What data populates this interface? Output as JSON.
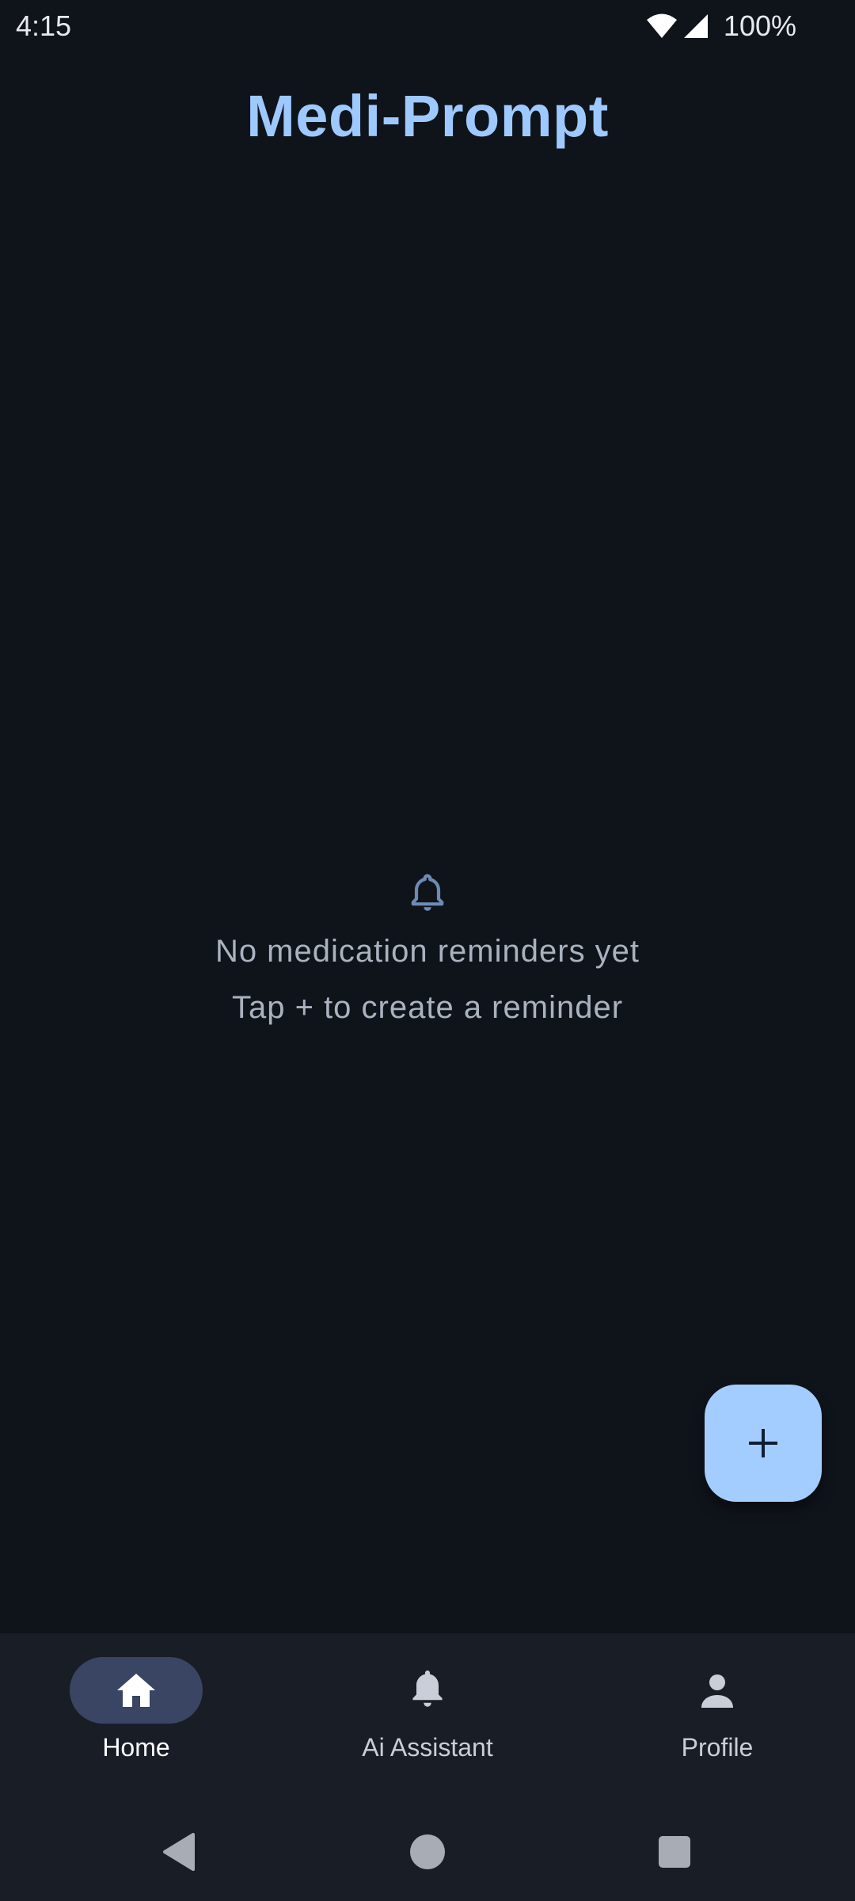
{
  "status_bar": {
    "time": "4:15",
    "battery": "100%"
  },
  "app": {
    "title": "Medi-Prompt"
  },
  "empty_state": {
    "icon": "bell-icon",
    "line1": "No medication reminders yet",
    "line2": "Tap + to create a reminder"
  },
  "fab": {
    "icon": "plus-icon"
  },
  "bottom_nav": {
    "items": [
      {
        "label": "Home",
        "icon": "home-icon",
        "active": true
      },
      {
        "label": "Ai Assistant",
        "icon": "bell-icon",
        "active": false
      },
      {
        "label": "Profile",
        "icon": "person-icon",
        "active": false
      }
    ]
  },
  "system_nav": {
    "buttons": [
      "back-icon",
      "home-circle-icon",
      "recents-icon"
    ]
  },
  "colors": {
    "background": "#0f141b",
    "title": "#9ec9ff",
    "fab": "#a3cdfe",
    "nav_background": "#181d26",
    "nav_active_pill": "#3a4563"
  }
}
